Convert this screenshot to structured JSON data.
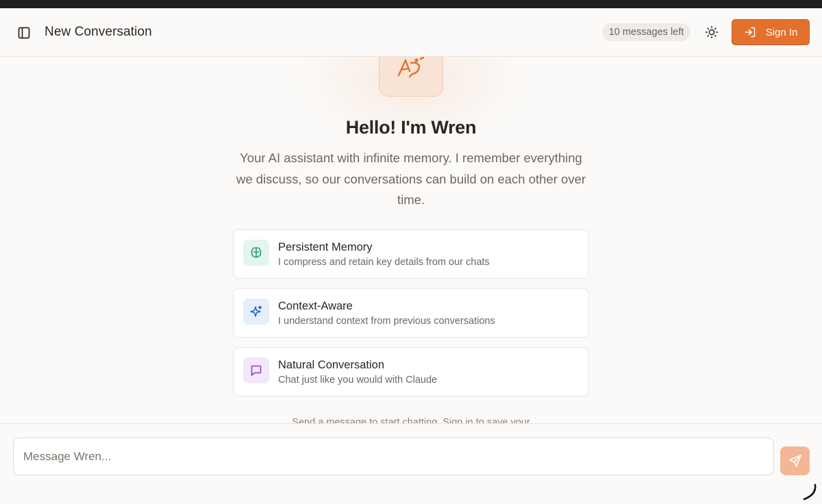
{
  "header": {
    "title": "New Conversation",
    "messages_left": "10 messages left",
    "sign_in_label": "Sign In"
  },
  "hero": {
    "title": "Hello! I'm Wren",
    "subtitle": "Your AI assistant with infinite memory. I remember everything we discuss, so our conversations can build on each other over time."
  },
  "features": [
    {
      "title": "Persistent Memory",
      "description": "I compress and retain key details from our chats",
      "icon": "brain-icon",
      "icon_bg": "#e4f5ee",
      "icon_color": "#1f9d6b"
    },
    {
      "title": "Context-Aware",
      "description": "I understand context from previous conversations",
      "icon": "sparkles-icon",
      "icon_bg": "#e6eefb",
      "icon_color": "#2f5fc4"
    },
    {
      "title": "Natural Conversation",
      "description": "Chat just like you would with Claude",
      "icon": "message-square-icon",
      "icon_bg": "#f3e8fa",
      "icon_color": "#8e3fc0"
    }
  ],
  "footnote": "Send a message to start chatting. Sign in to save your",
  "composer": {
    "placeholder": "Message Wren..."
  },
  "colors": {
    "accent": "#e4702e",
    "accent_light": "#f3b796",
    "background": "#fcfaf8"
  }
}
